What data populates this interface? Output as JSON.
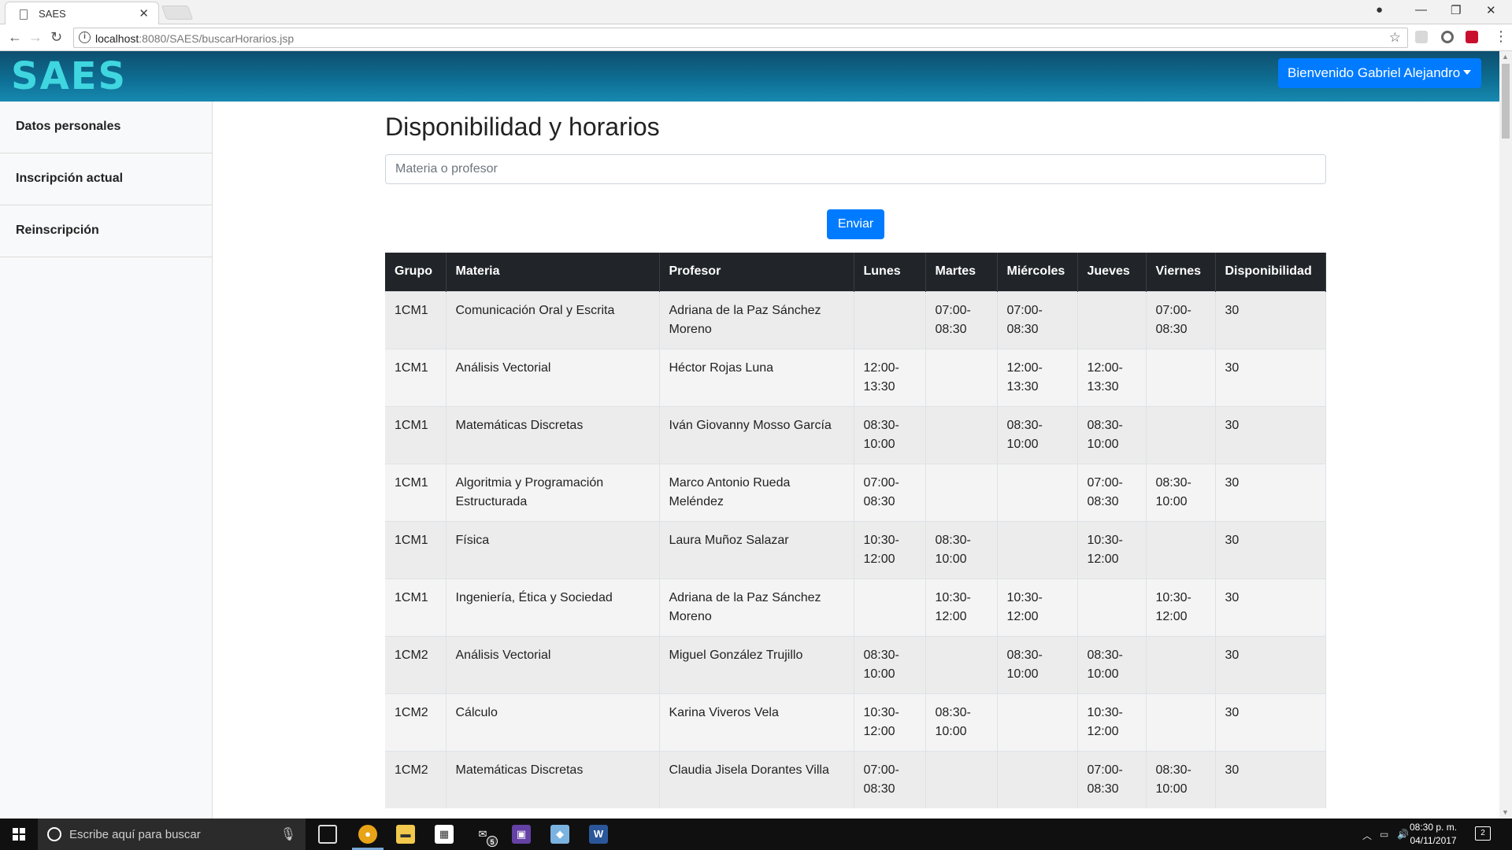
{
  "browser": {
    "tab_title": "SAES",
    "url_host": "localhost",
    "url_rest": ":8080/SAES/buscarHorarios.jsp"
  },
  "header": {
    "brand": "SAES",
    "user_menu_label": "Bienvenido Gabriel Alejandro"
  },
  "sidebar": {
    "items": [
      {
        "label": "Datos personales"
      },
      {
        "label": "Inscripción actual"
      },
      {
        "label": "Reinscripción"
      }
    ]
  },
  "main": {
    "title": "Disponibilidad y horarios",
    "search_placeholder": "Materia o profesor",
    "search_value": "",
    "submit_label": "Enviar"
  },
  "table": {
    "headers": [
      "Grupo",
      "Materia",
      "Profesor",
      "Lunes",
      "Martes",
      "Miércoles",
      "Jueves",
      "Viernes",
      "Disponibilidad"
    ],
    "rows": [
      [
        "1CM1",
        "Comunicación Oral y Escrita",
        "Adriana de la Paz Sánchez Moreno",
        "",
        "07:00-08:30",
        "07:00-08:30",
        "",
        "07:00-08:30",
        "30"
      ],
      [
        "1CM1",
        "Análisis Vectorial",
        "Héctor Rojas Luna",
        "12:00-13:30",
        "",
        "12:00-13:30",
        "12:00-13:30",
        "",
        "30"
      ],
      [
        "1CM1",
        "Matemáticas Discretas",
        "Iván Giovanny Mosso García",
        "08:30-10:00",
        "",
        "08:30-10:00",
        "08:30-10:00",
        "",
        "30"
      ],
      [
        "1CM1",
        "Algoritmia y Programación Estructurada",
        "Marco Antonio Rueda Meléndez",
        "07:00-08:30",
        "",
        "",
        "07:00-08:30",
        "08:30-10:00",
        "30"
      ],
      [
        "1CM1",
        "Física",
        "Laura Muñoz Salazar",
        "10:30-12:00",
        "08:30-10:00",
        "",
        "10:30-12:00",
        "",
        "30"
      ],
      [
        "1CM1",
        "Ingeniería, Ética y Sociedad",
        "Adriana de la Paz Sánchez Moreno",
        "",
        "10:30-12:00",
        "10:30-12:00",
        "",
        "10:30-12:00",
        "30"
      ],
      [
        "1CM2",
        "Análisis Vectorial",
        "Miguel González Trujillo",
        "08:30-10:00",
        "",
        "08:30-10:00",
        "08:30-10:00",
        "",
        "30"
      ],
      [
        "1CM2",
        "Cálculo",
        "Karina Viveros Vela",
        "10:30-12:00",
        "08:30-10:00",
        "",
        "10:30-12:00",
        "",
        "30"
      ],
      [
        "1CM2",
        "Matemáticas Discretas",
        "Claudia Jisela Dorantes Villa",
        "07:00-08:30",
        "",
        "",
        "07:00-08:30",
        "08:30-10:00",
        "30"
      ]
    ]
  },
  "taskbar": {
    "search_placeholder": "Escribe aquí para buscar",
    "mail_badge": "5",
    "time": "08:30 p. m.",
    "date": "04/11/2017",
    "notification_count": "2"
  },
  "colors": {
    "accent": "#007bff",
    "navbar_dark": "#0e4f6e",
    "navbar_light": "#1789b0",
    "brand_cyan": "#3fd6e0",
    "table_header": "#212529"
  }
}
